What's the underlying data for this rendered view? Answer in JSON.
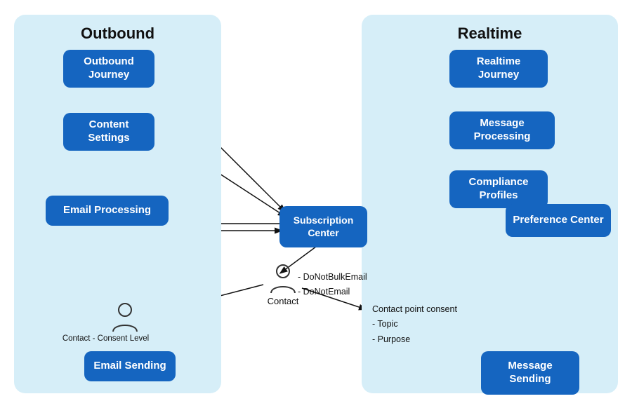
{
  "diagram": {
    "title_outbound": "Outbound",
    "title_realtime": "Realtime",
    "boxes": {
      "outbound_journey": "Outbound\nJourney",
      "content_settings": "Content\nSettings",
      "email_processing": "Email\nProcessing",
      "subscription_center": "Subscription\nCenter",
      "email_sending": "Email\nSending",
      "realtime_journey": "Realtime\nJourney",
      "message_processing": "Message\nProcessing",
      "compliance_profiles": "Compliance\nProfiles",
      "preference_center": "Preference\nCenter",
      "message_sending": "Message\nSending"
    },
    "notes": {
      "contact_fields": "- DoNotBulkEmail\n- DoNotEmail",
      "contact_label_center": "Contact",
      "contact_left_label": "Contact -   Consent Level",
      "contact_point": "Contact point consent\n- Topic\n- Purpose"
    }
  }
}
